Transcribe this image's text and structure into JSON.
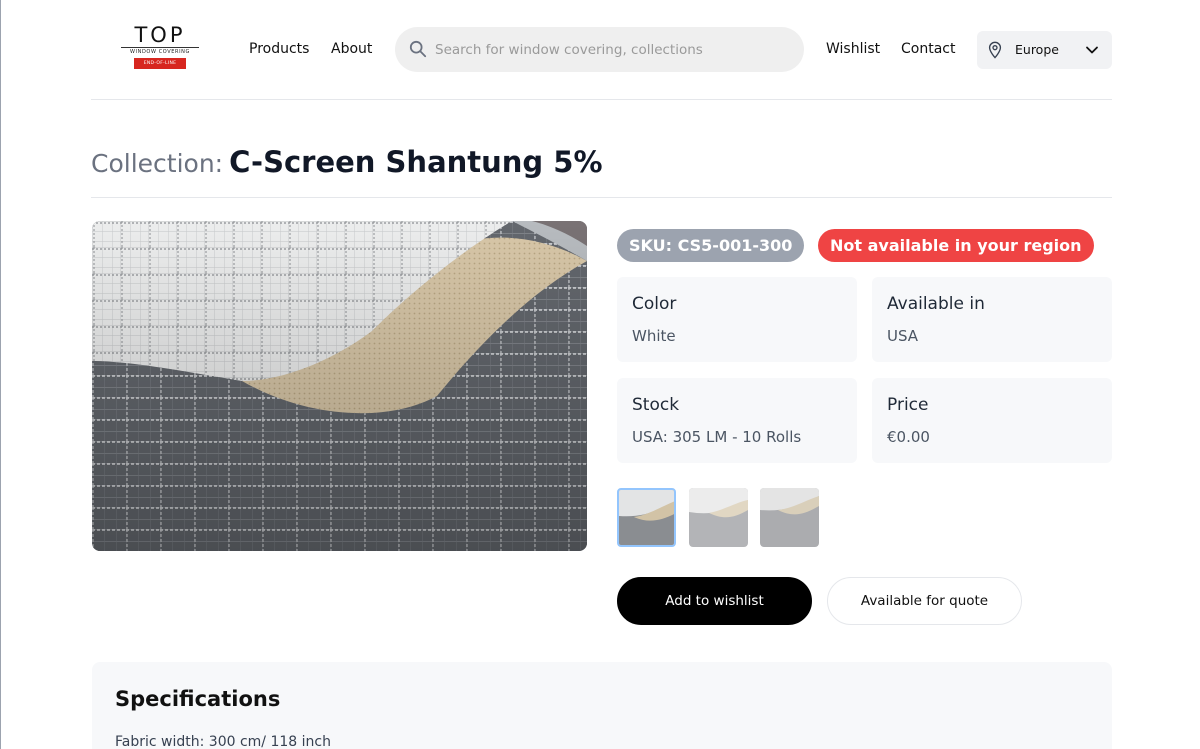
{
  "header": {
    "logo": {
      "wordmark": "TOP",
      "subtitle": "WINDOW COVERING",
      "badge": "END-OF-LINE"
    },
    "nav": {
      "products": "Products",
      "about": "About",
      "wishlist": "Wishlist",
      "contact": "Contact"
    },
    "search": {
      "placeholder": "Search for window covering, collections",
      "value": ""
    },
    "region": {
      "selected": "Europe"
    }
  },
  "product": {
    "collection_prefix": "Collection:",
    "name": "C-Screen Shantung 5%",
    "sku": "SKU: CS5-001-300",
    "availability_badge": "Not available in your region",
    "details": [
      {
        "label": "Color",
        "value": "White"
      },
      {
        "label": "Available in",
        "value": "USA"
      },
      {
        "label": "Stock",
        "value": "USA: 305 LM - 10 Rolls"
      },
      {
        "label": "Price",
        "value": "€0.00"
      }
    ],
    "thumbnails_count": 3,
    "actions": {
      "wishlist": "Add to wishlist",
      "quote": "Available for quote"
    }
  },
  "specifications": {
    "heading": "Specifications",
    "lines": [
      "Fabric width: 300 cm/ 118 inch"
    ]
  },
  "colors": {
    "badge_gray": "#9ca3af",
    "badge_red": "#ef4444",
    "card_bg": "#f7f8fa",
    "primary_button": "#000000"
  }
}
